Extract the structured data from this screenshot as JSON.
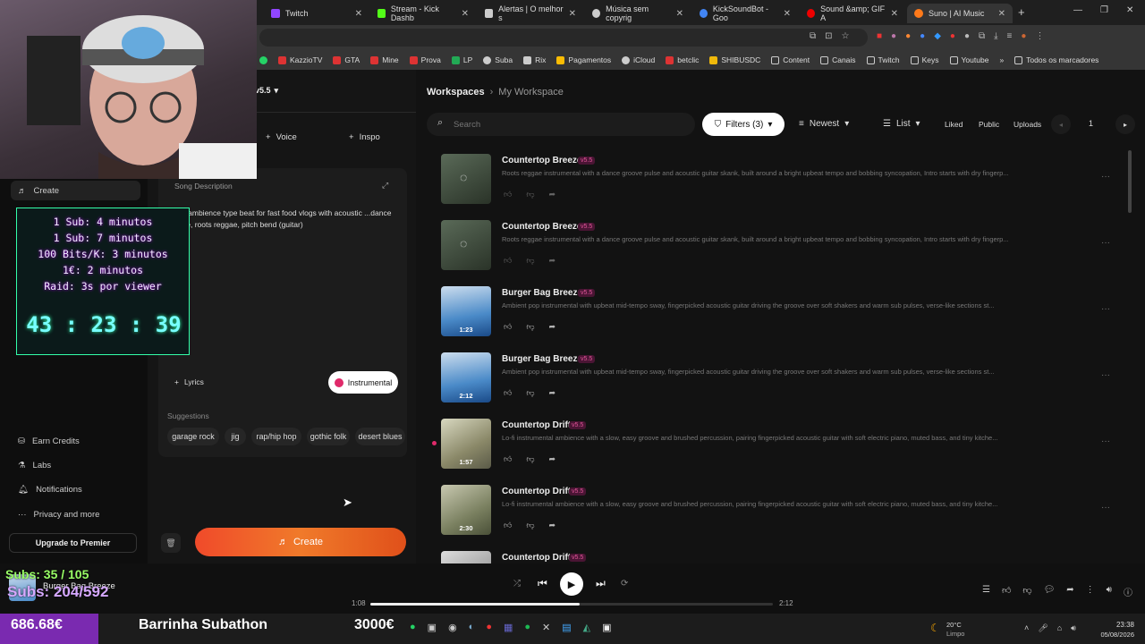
{
  "tabs": [
    {
      "label": "Twitch",
      "color": "#9146ff"
    },
    {
      "label": "Stream - Kick Dashb",
      "color": "#53fc18"
    },
    {
      "label": "Alertas | O melhor s",
      "color": "#cccccc"
    },
    {
      "label": "Música sem copyrig",
      "color": "#cccccc"
    },
    {
      "label": "KickSoundBot - Goo",
      "color": "#4285f4"
    },
    {
      "label": "Sound &amp; GIF A",
      "color": "#e00"
    },
    {
      "label": "Suno | AI Music",
      "color": "#ff7a1a"
    }
  ],
  "bookmarks": [
    "KazzioTV",
    "GTA",
    "Mine",
    "Prova",
    "LP",
    "Suba",
    "Rix",
    "Pagamentos",
    "iCloud",
    "betclic",
    "SHIBUSDC",
    "Content",
    "Canais",
    "Twitch",
    "Keys",
    "Youtube",
    "Todos os marcadores"
  ],
  "sidebar": {
    "create": "Create",
    "earn": "Earn Credits",
    "labs": "Labs",
    "notifications": "Notifications",
    "privacy": "Privacy and more",
    "upgrade": "Upgrade to Premier"
  },
  "leftpanel": {
    "version": "v5.5",
    "voice": "Voice",
    "inspo": "Inspo",
    "song_desc_label": "Song Description",
    "song_desc": "...ntal ambience type beat for fast food vlogs with acoustic ...dance groove, roots reggae, pitch bend (guitar)",
    "lyrics": "Lyrics",
    "instrumental": "Instrumental",
    "suggestions_label": "Suggestions",
    "suggestions": [
      "garage rock",
      "jig",
      "rap/hip hop",
      "gothic folk",
      "desert blues"
    ],
    "create_btn": "Create"
  },
  "main": {
    "breadcrumb_root": "Workspaces",
    "breadcrumb_current": "My Workspace",
    "search_placeholder": "Search",
    "filters": "Filters (3)",
    "sort": "Newest",
    "view": "List",
    "liked": "Liked",
    "public": "Public",
    "uploads": "Uploads",
    "page": "1"
  },
  "songs": [
    {
      "title": "Countertop Breeze",
      "version": "v5.5",
      "desc": "Roots reggae instrumental with a dance groove pulse and acoustic guitar skank, built around a bright upbeat tempo and bobbing syncopation, Intro starts with dry fingerp...",
      "duration": "",
      "thumb": "#4a5a48"
    },
    {
      "title": "Countertop Breeze",
      "version": "v5.5",
      "desc": "Roots reggae instrumental with a dance groove pulse and acoustic guitar skank, built around a bright upbeat tempo and bobbing syncopation, Intro starts with dry fingerp...",
      "duration": "",
      "thumb": "#4a5a48"
    },
    {
      "title": "Burger Bag Breeze",
      "version": "v5.5",
      "desc": "Ambient pop instrumental with upbeat mid-tempo sway, fingerpicked acoustic guitar driving the groove over soft shakers and warm sub pulses, verse-like sections st...",
      "duration": "1:23",
      "thumb": "#3a7ab8"
    },
    {
      "title": "Burger Bag Breeze",
      "version": "v5.5",
      "desc": "Ambient pop instrumental with upbeat mid-tempo sway, fingerpicked acoustic guitar driving the groove over soft shakers and warm sub pulses, verse-like sections st...",
      "duration": "2:12",
      "thumb": "#3a7ab8"
    },
    {
      "title": "Countertop Drift",
      "version": "v5.5",
      "desc": "Lo-fi instrumental ambience with a slow, easy groove and brushed percussion, pairing fingerpicked acoustic guitar with soft electric piano, muted bass, and tiny kitche...",
      "duration": "1:57",
      "thumb": "#a8a890"
    },
    {
      "title": "Countertop Drift",
      "version": "v5.5",
      "desc": "Lo-fi instrumental ambience with a slow, easy groove and brushed percussion, pairing fingerpicked acoustic guitar with soft electric piano, muted bass, and tiny kitche...",
      "duration": "2:30",
      "thumb": "#8a9070"
    },
    {
      "title": "Countertop Drift",
      "version": "v5.5",
      "desc": "",
      "duration": "",
      "thumb": "#ccc"
    }
  ],
  "player": {
    "title": "Burger Bag Breeze",
    "elapsed": "1:08",
    "total": "2:12",
    "progress": 0.52
  },
  "overlay": {
    "timer_lines": [
      "1 Sub: 4 minutos",
      "1 Sub: 7 minutos",
      "100 Bits/K: 3 minutos",
      "1€: 2 minutos",
      "Raid: 3s por viewer"
    ],
    "timer": "43 : 23 : 39",
    "subs": "Subs: 35 / 105",
    "subs2": "Subs: 204/592",
    "money": "686.68€",
    "subathon": "Barrinha Subathon",
    "goal": "3000€"
  },
  "taskbar": {
    "weather": "20°C",
    "weather_desc": "Limpo",
    "time": "23:38",
    "date": "05/08/2026"
  }
}
